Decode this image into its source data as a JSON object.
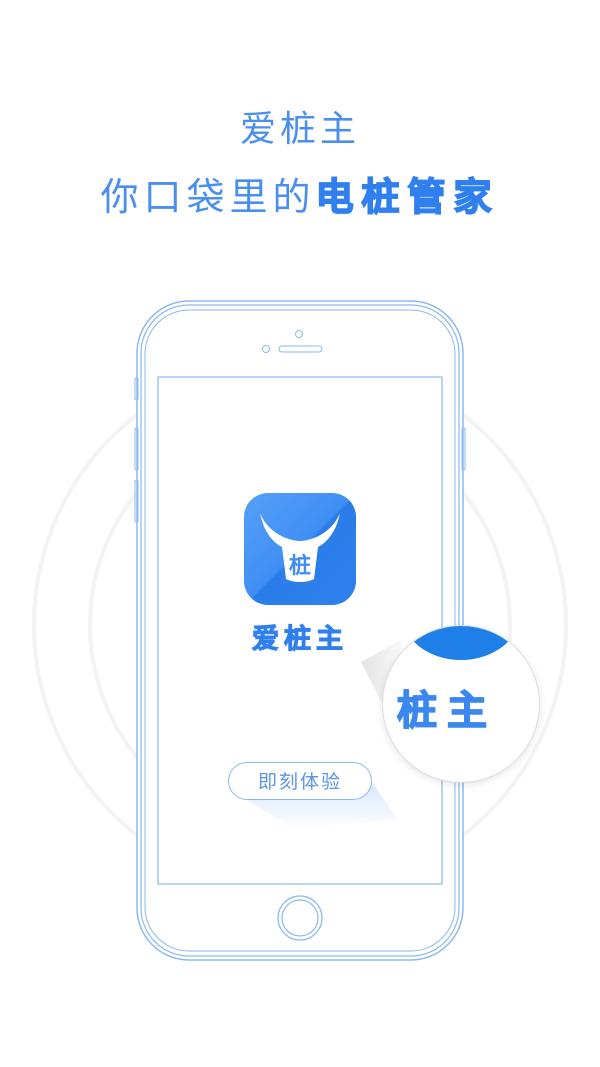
{
  "header": {
    "title": "爱桩主",
    "subtitle_regular": "你口袋里的",
    "subtitle_emphasis": "电桩管家"
  },
  "phone_screen": {
    "app_icon": {
      "name": "app-logo-icon",
      "badge_text": "桩"
    },
    "app_name": "爱桩主",
    "cta_button_label": "即刻体验"
  },
  "magnifier": {
    "text": "桩主"
  },
  "colors": {
    "brand_blue": "#2f80ee",
    "light_blue": "#4a8ff0",
    "outline_blue": "#8ab8f5",
    "background": "#ffffff"
  }
}
